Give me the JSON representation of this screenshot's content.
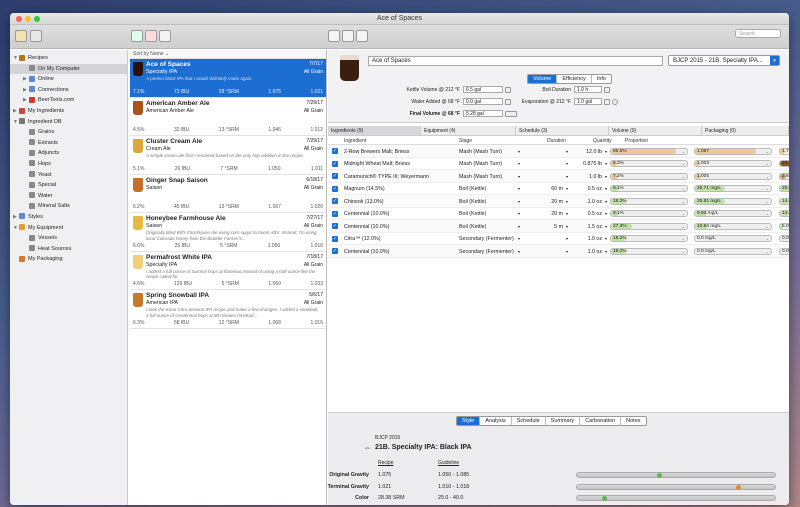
{
  "window": {
    "title": "Ace of Spaces"
  },
  "toolbar": {
    "search_placeholder": "Search"
  },
  "sidebar": {
    "items": [
      {
        "label": "Recipes",
        "indent": 0,
        "tri": "▼",
        "color": "#b5751e"
      },
      {
        "label": "On My Computer",
        "indent": 1,
        "tri": "",
        "color": "#8a8a8a",
        "selected": true
      },
      {
        "label": "Online",
        "indent": 1,
        "tri": "▶",
        "color": "#5a8bd1"
      },
      {
        "label": "Connections",
        "indent": 1,
        "tri": "▶",
        "color": "#5a8bd1"
      },
      {
        "label": "BeerTools.com",
        "indent": 1,
        "tri": "▶",
        "color": "#d23b2b"
      },
      {
        "label": "My Ingredients",
        "indent": 0,
        "tri": "▶",
        "color": "#c44"
      },
      {
        "label": "Ingredient DB",
        "indent": 0,
        "tri": "▼",
        "color": "#777"
      },
      {
        "label": "Grains",
        "indent": 1,
        "tri": "",
        "color": "#8a8a8a"
      },
      {
        "label": "Extracts",
        "indent": 1,
        "tri": "",
        "color": "#8a8a8a"
      },
      {
        "label": "Adjuncts",
        "indent": 1,
        "tri": "",
        "color": "#8a8a8a"
      },
      {
        "label": "Hops",
        "indent": 1,
        "tri": "",
        "color": "#8a8a8a"
      },
      {
        "label": "Yeast",
        "indent": 1,
        "tri": "",
        "color": "#8a8a8a"
      },
      {
        "label": "Special",
        "indent": 1,
        "tri": "",
        "color": "#8a8a8a"
      },
      {
        "label": "Water",
        "indent": 1,
        "tri": "",
        "color": "#8a8a8a"
      },
      {
        "label": "Mineral Salts",
        "indent": 1,
        "tri": "",
        "color": "#8a8a8a"
      },
      {
        "label": "Styles",
        "indent": 0,
        "tri": "▶",
        "color": "#5a8bd1"
      },
      {
        "label": "My Equipment",
        "indent": 0,
        "tri": "▼",
        "color": "#e0a030"
      },
      {
        "label": "Vessels",
        "indent": 1,
        "tri": "",
        "color": "#888"
      },
      {
        "label": "Heat Sources",
        "indent": 1,
        "tri": "",
        "color": "#888"
      },
      {
        "label": "My Packaging",
        "indent": 0,
        "tri": "",
        "color": "#d27a2a"
      }
    ]
  },
  "list": {
    "sort_label": "Sort by Name",
    "recipes": [
      {
        "name": "Ace of Spaces",
        "date": "7/7/17",
        "style": "Specialty IPA",
        "grain": "All Grain",
        "desc": "A perfect black IPA that I would definitely make again.",
        "abv": "7.1%",
        "ibu": "72 IBU",
        "srm": "28 °SRM",
        "og": "1.075",
        "fg": "1.021",
        "glass": "#2a1208",
        "selected": true
      },
      {
        "name": "American Amber Ale",
        "date": "7/29/17",
        "style": "American Amber Ale",
        "grain": "All Grain",
        "desc": "",
        "abv": "4.5%",
        "ibu": "32 IBU",
        "srm": "13 °SRM",
        "og": "1.046",
        "fg": "1.012",
        "glass": "#a9521c"
      },
      {
        "name": "Cluster Cream Ale",
        "date": "7/29/17",
        "style": "Cream Ale",
        "grain": "All Grain",
        "desc": "A simple cream ale that I renamed based on the only hop addition in the recipe.",
        "abv": "5.1%",
        "ibu": "26 IBU",
        "srm": "7 °SRM",
        "og": "1.050",
        "fg": "1.011",
        "glass": "#dca63a"
      },
      {
        "name": "Ginger Snap Saison",
        "date": "6/18/17",
        "style": "Saison",
        "grain": "All Grain",
        "desc": "",
        "abv": "6.2%",
        "ibu": "45 IBU",
        "srm": "13 °SRM",
        "og": "1.067",
        "fg": "1.020",
        "glass": "#c46f2a"
      },
      {
        "name": "Honeybee Farmhouse Ale",
        "date": "7/27/17",
        "style": "Saison",
        "grain": "All Grain",
        "desc": "Originally titled Bill's Farmhouse Ale using corn sugar to boost ABV. Instead, I'm using local Colorado honey from the Boulder Farmer's...",
        "abv": "6.6%",
        "ibu": "25 IBU",
        "srm": "5 °SRM",
        "og": "1.056",
        "fg": "1.010",
        "glass": "#e6b84a"
      },
      {
        "name": "Permafrost White IPA",
        "date": "7/18/17",
        "style": "Specialty IPA",
        "grain": "All Grain",
        "desc": "I added a full ounce of Summit hops at flameout instead of using a half ounce like the recipe called for.",
        "abv": "4.6%",
        "ibu": "129 IBU",
        "srm": "5 °SRM",
        "og": "1.069",
        "fg": "1.033",
        "glass": "#eed07a"
      },
      {
        "name": "Spring Snowball IPA",
        "date": "5/6/17",
        "style": "American IPA",
        "grain": "All Grain",
        "desc": "I took the Kona Citra Session IPA recipe and make a few changes. I added a snowball, 1 full ounce of Centennial hops at 80 minutes (instead...",
        "abv": "6.3%",
        "ibu": "58 IBU",
        "srm": "12 °SRM",
        "og": "1.068",
        "fg": "1.016",
        "glass": "#c47a2a"
      }
    ]
  },
  "header": {
    "recipe_name": "Ace of Spaces",
    "style_select": "BJCP 2015 - 21B. Specialty IPA...",
    "tabs": [
      {
        "label": "Volume",
        "on": true
      },
      {
        "label": "Efficiency",
        "on": false
      },
      {
        "label": "Info",
        "on": false
      }
    ],
    "kettle_label": "Kettle Volume @ 212 °F",
    "kettle_value": "6.5 gal",
    "water_label": "Water Added @ 68 °F",
    "water_value": "0.0 gal",
    "final_label": "Final Volume @ 68 °F",
    "final_value": "5.28 gal",
    "boil_label": "Boil Duration",
    "boil_value": "1.0 h",
    "evap_label": "Evaporation @ 212 °F",
    "evap_value": "1.0 gal"
  },
  "tables": {
    "ingredients": "Ingredients (9)",
    "equipment": "Equipment (4)",
    "schedule": "Schedule (3)",
    "volume": "Volume (0)",
    "packaging": "Packaging (0)",
    "col_ingredient": "Ingredient",
    "col_stage": "Stage",
    "col_duration": "Duration",
    "col_quantity": "Quantity",
    "col_proportion": "Proportion"
  },
  "ingredients": [
    {
      "name": "2-Row Brewers Malt; Briess",
      "stage": "Mash (Mash Turn)",
      "dur": "",
      "qty": "12.0 lb",
      "p1": "86.5%",
      "p1f": 0.86,
      "p1c": "#e9c99a",
      "p2": "1.067",
      "p2f": 0.8,
      "p2c": "#e9c99a",
      "p3": "1.7 SRM",
      "p3f": 0.1,
      "p3c": "#e9c99a"
    },
    {
      "name": "Midnight Wheat Malt; Briess",
      "stage": "Mash (Mash Turn)",
      "dur": "",
      "qty": "0.875 lb",
      "p1": "6.3%",
      "p1f": 0.08,
      "p1c": "#e9c99a",
      "p2": "1.003",
      "p2f": 0.06,
      "p2c": "#e9c99a",
      "p3": "24.4 SRM",
      "p3f": 0.9,
      "p3c": "#8a5a2a"
    },
    {
      "name": "Caramunich® TYPE III; Weyermann",
      "stage": "Mash (Mash Turn)",
      "dur": "",
      "qty": "1.0 lb",
      "p1": "7.2%",
      "p1f": 0.09,
      "p1c": "#e9c99a",
      "p2": "1.005",
      "p2f": 0.08,
      "p2c": "#e9c99a",
      "p3": "2.55 SRM",
      "p3f": 0.12,
      "p3c": "#c9a070"
    },
    {
      "name": "Magnum (14.5%)",
      "stage": "Boil (Kettle)",
      "dur": "60 m",
      "qty": "0.5 oz",
      "p1": "9.1%",
      "p1f": 0.1,
      "p1c": "#bfe0a8",
      "p2": "25.71 mg/L",
      "p2f": 0.4,
      "p2c": "#bfe0a8",
      "p3": "25.0% U",
      "p3f": 0.3,
      "p3c": "#bfe0a8"
    },
    {
      "name": "Chinook (13.0%)",
      "stage": "Boil (Kettle)",
      "dur": "20 m",
      "qty": "1.0 oz",
      "p1": "18.2%",
      "p1f": 0.2,
      "p1c": "#bfe0a8",
      "p2": "25.81 mg/L",
      "p2f": 0.4,
      "p2c": "#bfe0a8",
      "p3": "14.0% U",
      "p3f": 0.18,
      "p3c": "#bfe0a8"
    },
    {
      "name": "Centennial (10.0%)",
      "stage": "Boil (Kettle)",
      "dur": "20 m",
      "qty": "0.5 oz",
      "p1": "9.1%",
      "p1f": 0.1,
      "p1c": "#bfe0a8",
      "p2": "9.93 mg/L",
      "p2f": 0.16,
      "p2c": "#bfe0a8",
      "p3": "14.0% U",
      "p3f": 0.18,
      "p3c": "#bfe0a8"
    },
    {
      "name": "Centennial (10.0%)",
      "stage": "Boil (Kettle)",
      "dur": "5 m",
      "qty": "1.5 oz",
      "p1": "27.3%",
      "p1f": 0.27,
      "p1c": "#bfe0a8",
      "p2": "10.84 mg/L",
      "p2f": 0.17,
      "p2c": "#bfe0a8",
      "p3": "5.0% U",
      "p3f": 0.07,
      "p3c": "#bfe0a8"
    },
    {
      "name": "Citra™ (12.0%)",
      "stage": "Secondary (Fermenter)",
      "dur": "",
      "qty": "1.0 oz",
      "p1": "18.2%",
      "p1f": 0.2,
      "p1c": "#bfe0a8",
      "p2": "0.0 mg/L",
      "p2f": 0.0,
      "p2c": "#bfe0a8",
      "p3": "0.0% U",
      "p3f": 0.0,
      "p3c": "#bfe0a8"
    },
    {
      "name": "Centennial (10.0%)",
      "stage": "Secondary (Fermenter)",
      "dur": "",
      "qty": "1.0 oz",
      "p1": "18.2%",
      "p1f": 0.2,
      "p1c": "#bfe0a8",
      "p2": "0.0 mg/L",
      "p2f": 0.0,
      "p2c": "#bfe0a8",
      "p3": "0.0% U",
      "p3f": 0.0,
      "p3c": "#bfe0a8"
    }
  ],
  "profile": {
    "tabs": [
      {
        "label": "Style",
        "on": true
      },
      {
        "label": "Analysis",
        "on": false
      },
      {
        "label": "Schedule",
        "on": false
      },
      {
        "label": "Summary",
        "on": false
      },
      {
        "label": "Carbonation",
        "on": false
      },
      {
        "label": "Notes",
        "on": false
      }
    ],
    "guide": "BJCP 2015",
    "style_name": "21B. Specialty IPA: Black IPA",
    "col_recipe": "Recipe",
    "col_guideline": "Guideline",
    "rows": [
      {
        "label": "Original Gravity",
        "recipe": "1.075",
        "guide": "1.050 - 1.085",
        "pos": 0.41,
        "color": "#5ab84a"
      },
      {
        "label": "Terminal Gravity",
        "recipe": "1.021",
        "guide": "1.010 - 1.018",
        "pos": 0.81,
        "color": "#e08a2a"
      },
      {
        "label": "Color",
        "recipe": "28.38 SRM",
        "guide": "25.0 - 40.0",
        "pos": 0.13,
        "color": "#5ab84a"
      },
      {
        "label": "Alcohol",
        "recipe": "7.07%",
        "guide": "5.5% - 9.0%",
        "pos": 0.25,
        "color": "#5ab84a"
      },
      {
        "label": "Bitterness",
        "recipe": "72.1",
        "guide": "50.0 - 90.0",
        "pos": 0.3,
        "color": "#5ab84a"
      }
    ]
  }
}
